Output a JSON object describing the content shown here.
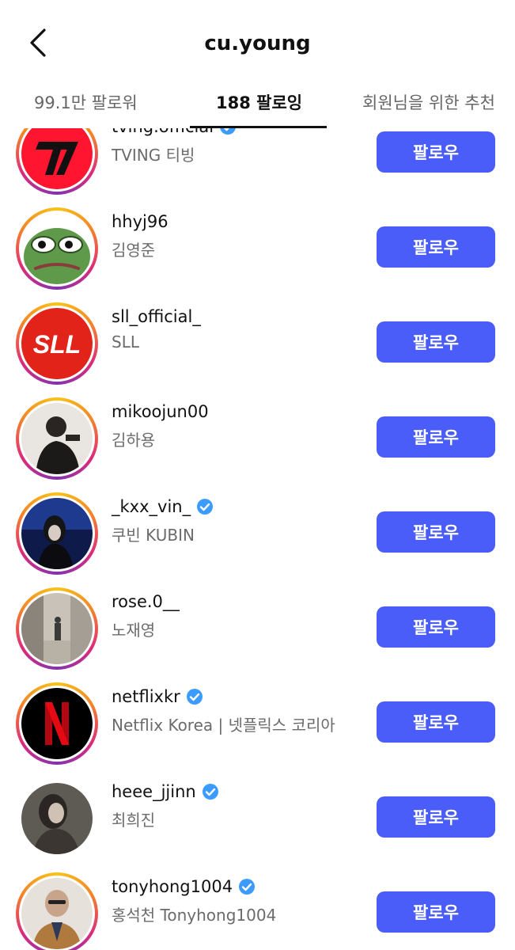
{
  "header": {
    "title": "cu.young",
    "back_icon": "chevron-left-icon"
  },
  "tabs": [
    {
      "label": "99.1만 팔로워"
    },
    {
      "label": "188 팔로잉",
      "active": true
    },
    {
      "label": "회원님을 위한 추천"
    }
  ],
  "colors": {
    "follow_button": "#4a5df8",
    "verified": "#3b9bff",
    "active_tab": "#111111"
  },
  "follow_label": "팔로우",
  "accounts": [
    {
      "username": "tving.official",
      "name": "TVING 티빙",
      "verified": true,
      "avatar": "tving-logo"
    },
    {
      "username": "hhyj96",
      "name": "김영준",
      "verified": false,
      "avatar": "pepe-frog"
    },
    {
      "username": "sll_official_",
      "name": "SLL",
      "verified": false,
      "avatar": "sll-logo"
    },
    {
      "username": "mikoojun00",
      "name": "김하용",
      "verified": false,
      "avatar": "person-photo"
    },
    {
      "username": "_kxx_vin_",
      "name": "쿠빈 KUBIN",
      "verified": true,
      "avatar": "person-photo-dark"
    },
    {
      "username": "rose.0__",
      "name": "노재영",
      "verified": false,
      "avatar": "street-photo"
    },
    {
      "username": "netflixkr",
      "name": "Netflix Korea | 넷플릭스 코리아",
      "verified": true,
      "avatar": "netflix-logo"
    },
    {
      "username": "heee_jjinn",
      "name": "최희진",
      "verified": true,
      "avatar": "person-photo"
    },
    {
      "username": "tonyhong1004",
      "name": "홍석천 Tonyhong1004",
      "verified": true,
      "avatar": "person-photo-bald"
    }
  ]
}
